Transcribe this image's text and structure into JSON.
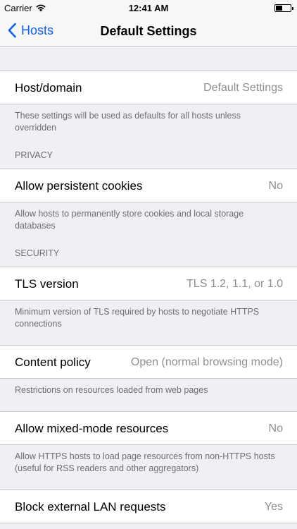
{
  "status": {
    "carrier": "Carrier",
    "time": "12:41 AM"
  },
  "nav": {
    "back_label": "Hosts",
    "title": "Default Settings"
  },
  "settings": {
    "host": {
      "label": "Host/domain",
      "value": "Default Settings",
      "footer": "These settings will be used as defaults for all hosts unless overridden"
    },
    "privacy_header": "PRIVACY",
    "cookies": {
      "label": "Allow persistent cookies",
      "value": "No",
      "footer": "Allow hosts to permanently store cookies and local storage databases"
    },
    "security_header": "SECURITY",
    "tls": {
      "label": "TLS version",
      "value": "TLS 1.2, 1.1, or 1.0",
      "footer": "Minimum version of TLS required by hosts to negotiate HTTPS connections"
    },
    "content_policy": {
      "label": "Content policy",
      "value": "Open (normal browsing mode)",
      "footer": "Restrictions on resources loaded from web pages"
    },
    "mixed_mode": {
      "label": "Allow mixed-mode resources",
      "value": "No",
      "footer": "Allow HTTPS hosts to load page resources from non-HTTPS hosts (useful for RSS readers and other aggregators)"
    },
    "lan": {
      "label": "Block external LAN requests",
      "value": "Yes"
    }
  },
  "colors": {
    "accent": "#0a60ff",
    "background": "#efeff4"
  }
}
